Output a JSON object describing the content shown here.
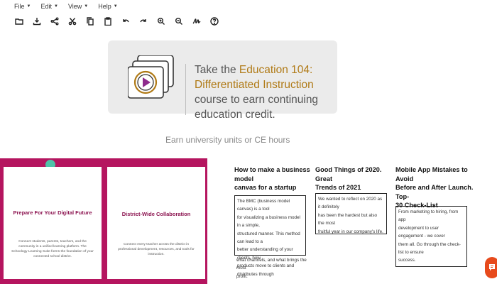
{
  "menubar": {
    "items": [
      {
        "label": "File",
        "name": "menu-file"
      },
      {
        "label": "Edit",
        "name": "menu-edit"
      },
      {
        "label": "View",
        "name": "menu-view"
      },
      {
        "label": "Help",
        "name": "menu-help"
      }
    ]
  },
  "toolbar": {
    "icons": [
      "folder-open-icon",
      "download-icon",
      "share-icon",
      "cut-icon",
      "copy-icon",
      "paste-icon",
      "undo-icon",
      "redo-icon",
      "zoom-in-icon",
      "zoom-out-icon",
      "signature-icon",
      "help-icon"
    ]
  },
  "promo": {
    "prefix": "Take the ",
    "course_line1": "Education 104:",
    "course_line2": "Differentiated Instruction",
    "suffix_line1": "course to earn continuing",
    "suffix_line2": "education credit.",
    "subtitle": "Earn university units or CE hours",
    "accent_color": "#b07a16"
  },
  "feature_cards": [
    {
      "title": "Prepare For Your Digital Future",
      "description": "Connect students, parents, teachers, and the community in a unified learning platform. The Schoology Learning Suite forms the foundation of your connected school district."
    },
    {
      "title": "District-Wide Collaboration",
      "description": "Connect every teacher across the district in professional development, resources, and tools for instruction."
    }
  ],
  "articles": [
    {
      "title_line1": "How to make a business model",
      "title_line2": "canvas for a startup",
      "excerpt_lines": [
        "The BMC (business model canvas) is a tool",
        "for visualizing a business model in a simple,",
        "structured manner. This method can lead to a",
        "better understanding of your clients, how",
        "products move to clients and distributes through"
      ],
      "excerpt_extra_lines": [
        "what channels, and what brings the most",
        "profit."
      ]
    },
    {
      "title_line1": "Good Things of 2020. Great",
      "title_line2": "Trends of 2021",
      "excerpt_lines": [
        "We wanted to reflect on 2020 as it definitely",
        "has been the hardest but also the most",
        "fruitful year in our company's life."
      ],
      "excerpt_extra_lines": []
    },
    {
      "title_line1": "Mobile App Mistakes to Avoid",
      "title_line2": "Before and After Launch. Top-",
      "title_line3": "30 Check-List",
      "excerpt_lines": [
        "From marketing to hiring, from app",
        "development to user engagement - we cover",
        "them all. Go through the check-list to ensure",
        "success."
      ],
      "excerpt_extra_lines": []
    }
  ],
  "colors": {
    "magenta_band": "#b5155f",
    "card_title": "#8c1450",
    "chat_button": "#e74a1c"
  }
}
